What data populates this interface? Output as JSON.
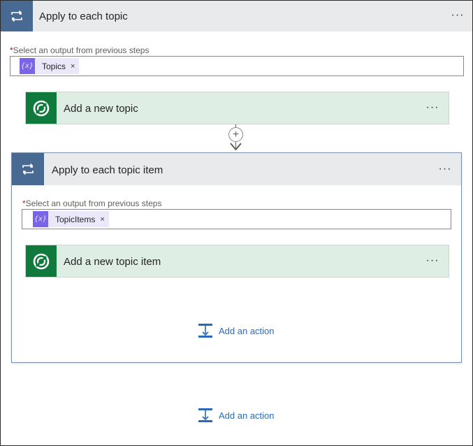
{
  "outer_loop": {
    "title": "Apply to each topic",
    "more_label": "···",
    "field_label": "Select an output from previous steps",
    "required_mark": "*",
    "token": {
      "icon": "{x}",
      "label": "Topics",
      "remove": "×"
    }
  },
  "action_add_topic": {
    "title": "Add a new topic",
    "more_label": "···",
    "icon": "dataverse-icon"
  },
  "connector": {
    "plus_label": "+"
  },
  "inner_loop": {
    "title": "Apply to each topic item",
    "more_label": "···",
    "field_label": "Select an output from previous steps",
    "required_mark": "*",
    "token": {
      "icon": "{x}",
      "label": "TopicItems",
      "remove": "×"
    }
  },
  "action_add_topic_item": {
    "title": "Add a new topic item",
    "more_label": "···",
    "icon": "dataverse-icon"
  },
  "inner_add_action": {
    "label": "Add an action",
    "icon": "add-action-icon"
  },
  "outer_add_action": {
    "label": "Add an action",
    "icon": "add-action-icon"
  },
  "colors": {
    "loop_icon_bg": "#486991",
    "action_icon_bg": "#0f7a3b",
    "action_card_bg": "#dfeee4",
    "token_bg": "#ece8fc",
    "token_icon_bg": "#7c64e9",
    "link": "#2b6ab8"
  }
}
